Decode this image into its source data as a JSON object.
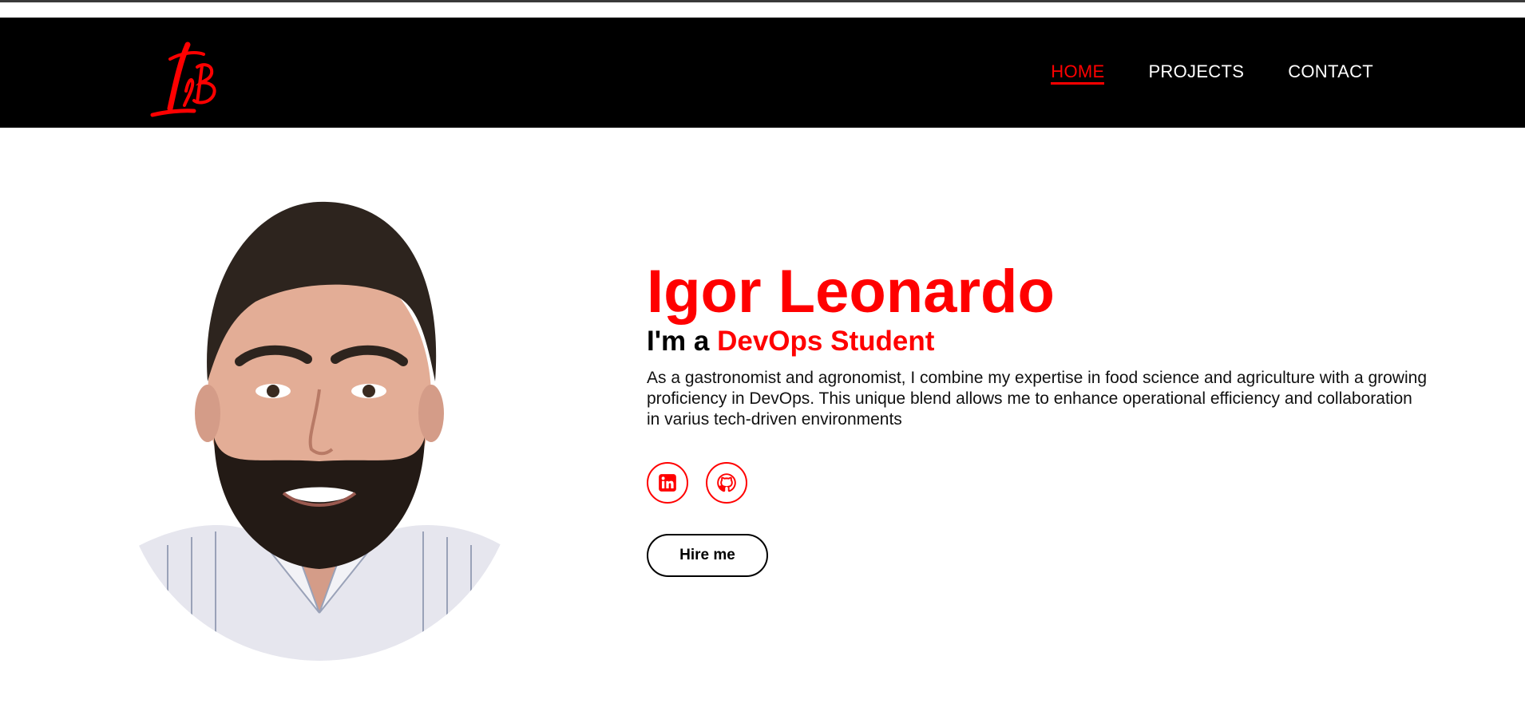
{
  "header": {
    "logo_text": "ILB",
    "nav": [
      {
        "label": "HOME",
        "active": true
      },
      {
        "label": "PROJECTS",
        "active": false
      },
      {
        "label": "CONTACT",
        "active": false
      }
    ]
  },
  "hero": {
    "name": "Igor Leonardo",
    "role_prefix": "I'm a",
    "role_highlight": "DevOps Student",
    "bio": "As a gastronomist and agronomist, I combine my expertise in food science and agriculture with a growing proficiency in DevOps. This unique blend allows me to enhance operational efficiency and collaboration in varius tech-driven environments",
    "socials": [
      {
        "icon": "linkedin-icon"
      },
      {
        "icon": "github-icon"
      }
    ],
    "cta_label": "Hire me"
  },
  "colors": {
    "accent": "#ff0000",
    "header_bg": "#000000",
    "text": "#000000"
  }
}
